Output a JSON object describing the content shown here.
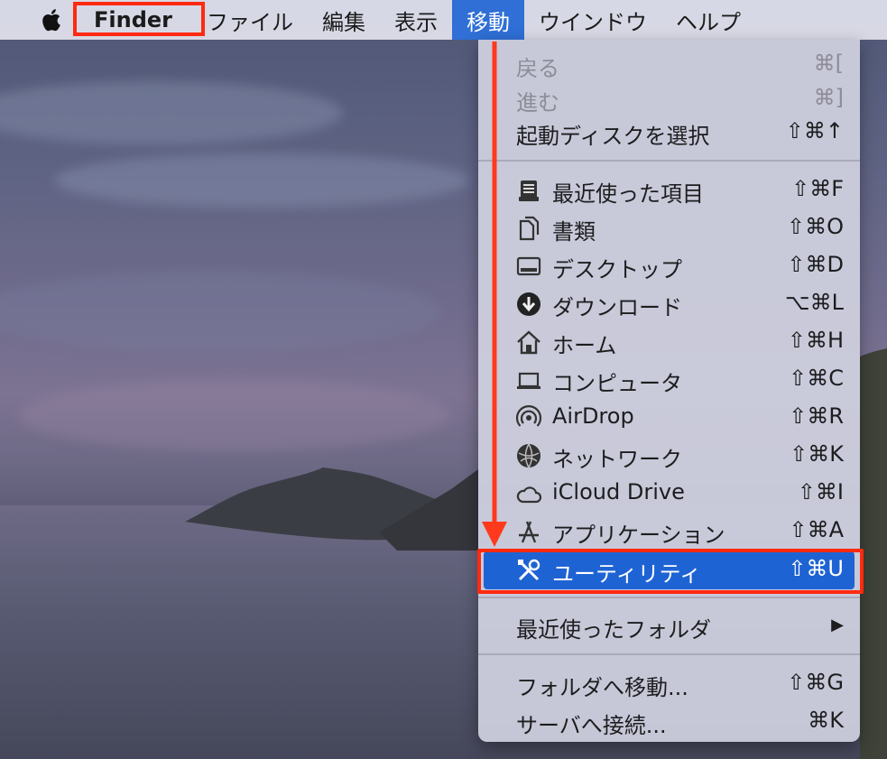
{
  "menubar": {
    "app_name": "Finder",
    "items": [
      "ファイル",
      "編集",
      "表示",
      "移動",
      "ウインドウ",
      "ヘルプ"
    ],
    "active_item": "移動"
  },
  "go_menu": {
    "items": [
      {
        "label": "戻る",
        "shortcut": "⌘[",
        "disabled": true
      },
      {
        "label": "進む",
        "shortcut": "⌘]",
        "disabled": true
      },
      {
        "label": "起動ディスクを選択",
        "shortcut": "⇧⌘↑"
      },
      {
        "label": "最近使った項目",
        "shortcut": "⇧⌘F",
        "icon": "recents-icon"
      },
      {
        "label": "書類",
        "shortcut": "⇧⌘O",
        "icon": "documents-icon"
      },
      {
        "label": "デスクトップ",
        "shortcut": "⇧⌘D",
        "icon": "desktop-icon"
      },
      {
        "label": "ダウンロード",
        "shortcut": "⌥⌘L",
        "icon": "downloads-icon"
      },
      {
        "label": "ホーム",
        "shortcut": "⇧⌘H",
        "icon": "home-icon"
      },
      {
        "label": "コンピュータ",
        "shortcut": "⇧⌘C",
        "icon": "computer-icon"
      },
      {
        "label": "AirDrop",
        "shortcut": "⇧⌘R",
        "icon": "airdrop-icon"
      },
      {
        "label": "ネットワーク",
        "shortcut": "⇧⌘K",
        "icon": "network-icon"
      },
      {
        "label": "iCloud Drive",
        "shortcut": "⇧⌘I",
        "icon": "icloud-icon"
      },
      {
        "label": "アプリケーション",
        "shortcut": "⇧⌘A",
        "icon": "applications-icon"
      },
      {
        "label": "ユーティリティ",
        "shortcut": "⇧⌘U",
        "icon": "utilities-icon",
        "highlighted": true
      },
      {
        "label": "最近使ったフォルダ",
        "shortcut": "▶",
        "submenu": true
      },
      {
        "label": "フォルダへ移動...",
        "shortcut": "⇧⌘G"
      },
      {
        "label": "サーバへ接続...",
        "shortcut": "⌘K"
      }
    ]
  },
  "colors": {
    "highlight": "#1e63d3",
    "annotation_red": "#ff2a10",
    "menubar_active": "#2f6fd6"
  }
}
